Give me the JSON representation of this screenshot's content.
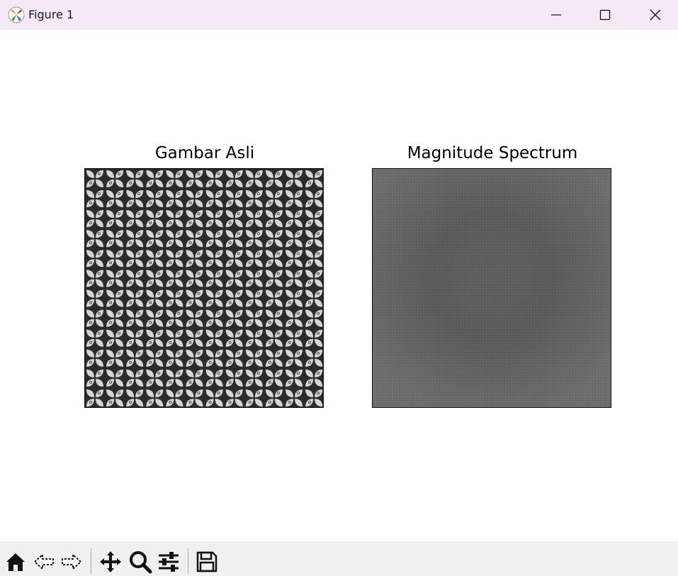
{
  "window": {
    "title": "Figure 1",
    "controls": {
      "minimize": "minimize-icon",
      "maximize": "maximize-icon",
      "close": "close-icon"
    }
  },
  "figure": {
    "subplots": [
      {
        "title": "Gambar Asli",
        "content": "repeating-kawung-pattern"
      },
      {
        "title": "Magnitude Spectrum",
        "content": "gray-noise-spectrum"
      }
    ]
  },
  "toolbar": {
    "tools": [
      "home-icon",
      "back-arrow-icon",
      "forward-arrow-icon",
      "pan-icon",
      "zoom-icon",
      "configure-subplots-icon",
      "save-icon"
    ]
  },
  "colors": {
    "titlebar_bg": "#f4e9f4",
    "toolbar_bg": "#f0f0f0",
    "pattern_dark": "#2b2b2b",
    "pattern_light": "#d6d6d6",
    "spectrum_gray": "#666666"
  }
}
